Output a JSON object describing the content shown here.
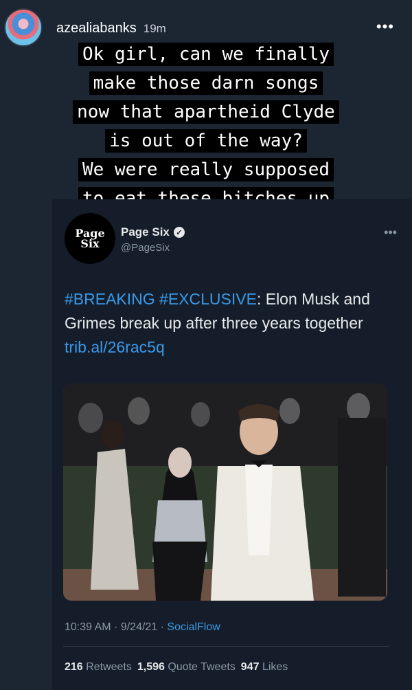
{
  "story": {
    "username": "azealiabanks",
    "time": "19m",
    "more": "•••",
    "caption_lines": [
      "Ok girl, can we finally",
      "make those darn songs",
      "now that apartheid Clyde",
      "is out of the way?",
      "We were really supposed",
      "to eat these bitches up"
    ]
  },
  "tweet": {
    "avatar_text_1": "Page",
    "avatar_text_2": "Six",
    "name": "Page Six",
    "verified": "✓",
    "handle": "@PageSix",
    "more": "•••",
    "text_hashtags": "#BREAKING #EXCLUSIVE",
    "text_body": ": Elon Musk and Grimes break up after three years together ",
    "link": "trib.al/26rac5q",
    "meta_time": "10:39 AM · 9/24/21 · ",
    "meta_source": "SocialFlow",
    "retweets_count": "216",
    "retweets_label": "Retweets",
    "quotes_count": "1,596",
    "quotes_label": "Quote Tweets",
    "likes_count": "947",
    "likes_label": "Likes"
  },
  "colors": {
    "background": "#1c2532",
    "card": "#141d29",
    "link_blue": "#3b9aea",
    "muted": "#8b98a5"
  }
}
